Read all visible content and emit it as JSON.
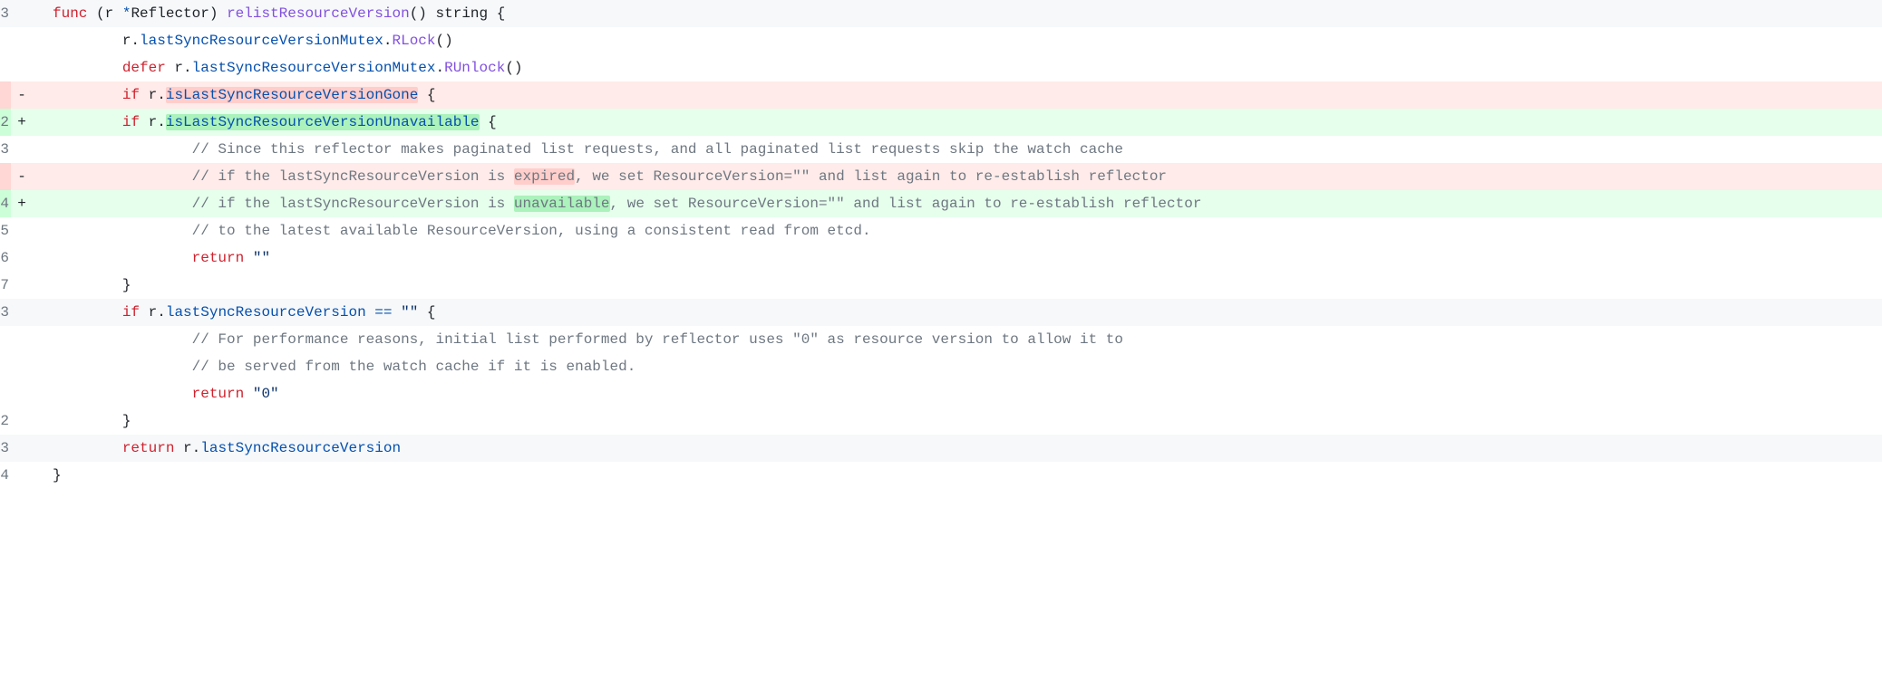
{
  "lines": [
    {
      "num": "3",
      "marker": "",
      "type": "hunk-header",
      "tokens": [
        {
          "t": "func ",
          "c": "tok-keyword"
        },
        {
          "t": "(",
          "c": "tok-paren"
        },
        {
          "t": "r ",
          "c": ""
        },
        {
          "t": "*",
          "c": "tok-op"
        },
        {
          "t": "Reflector",
          "c": "tok-type"
        },
        {
          "t": ") ",
          "c": "tok-paren"
        },
        {
          "t": "relistResourceVersion",
          "c": "tok-func"
        },
        {
          "t": "() ",
          "c": "tok-paren"
        },
        {
          "t": "string",
          "c": "tok-type"
        },
        {
          "t": " {",
          "c": ""
        }
      ]
    },
    {
      "num": "",
      "marker": "",
      "type": "context",
      "tokens": [
        {
          "t": "\t",
          "c": ""
        },
        {
          "t": "r",
          "c": ""
        },
        {
          "t": ".",
          "c": "tok-dot"
        },
        {
          "t": "lastSyncResourceVersionMutex",
          "c": "tok-ident"
        },
        {
          "t": ".",
          "c": "tok-dot"
        },
        {
          "t": "RLock",
          "c": "tok-func"
        },
        {
          "t": "()",
          "c": "tok-paren"
        }
      ]
    },
    {
      "num": "",
      "marker": "",
      "type": "context",
      "tokens": [
        {
          "t": "\t",
          "c": ""
        },
        {
          "t": "defer ",
          "c": "tok-keyword"
        },
        {
          "t": "r",
          "c": ""
        },
        {
          "t": ".",
          "c": "tok-dot"
        },
        {
          "t": "lastSyncResourceVersionMutex",
          "c": "tok-ident"
        },
        {
          "t": ".",
          "c": "tok-dot"
        },
        {
          "t": "RUnlock",
          "c": "tok-func"
        },
        {
          "t": "()",
          "c": "tok-paren"
        }
      ]
    },
    {
      "num": "",
      "marker": "",
      "type": "context",
      "tokens": []
    },
    {
      "num": "",
      "marker": "-",
      "type": "deletion",
      "tokens": [
        {
          "t": "\t",
          "c": ""
        },
        {
          "t": "if ",
          "c": "tok-keyword"
        },
        {
          "t": "r",
          "c": ""
        },
        {
          "t": ".",
          "c": "tok-dot"
        },
        {
          "t": "isLastSyncResourceVersionGone",
          "c": "tok-ident word-del"
        },
        {
          "t": " {",
          "c": ""
        }
      ]
    },
    {
      "num": "2",
      "marker": "+",
      "type": "addition",
      "tokens": [
        {
          "t": "\t",
          "c": ""
        },
        {
          "t": "if ",
          "c": "tok-keyword"
        },
        {
          "t": "r",
          "c": ""
        },
        {
          "t": ".",
          "c": "tok-dot"
        },
        {
          "t": "isLastSyncResourceVersionUnavailable",
          "c": "tok-ident word-add"
        },
        {
          "t": " {",
          "c": ""
        }
      ]
    },
    {
      "num": "3",
      "marker": "",
      "type": "context",
      "tokens": [
        {
          "t": "\t\t",
          "c": ""
        },
        {
          "t": "// Since this reflector makes paginated list requests, and all paginated list requests skip the watch cache",
          "c": "tok-comment"
        }
      ]
    },
    {
      "num": "",
      "marker": "-",
      "type": "deletion",
      "tokens": [
        {
          "t": "\t\t",
          "c": ""
        },
        {
          "t": "// if the lastSyncResourceVersion is ",
          "c": "tok-comment"
        },
        {
          "t": "expired",
          "c": "tok-comment word-del"
        },
        {
          "t": ", we set ResourceVersion=\"\" and list again to re-establish reflector",
          "c": "tok-comment"
        }
      ]
    },
    {
      "num": "4",
      "marker": "+",
      "type": "addition",
      "tokens": [
        {
          "t": "\t\t",
          "c": ""
        },
        {
          "t": "// if the lastSyncResourceVersion is ",
          "c": "tok-comment"
        },
        {
          "t": "unavailable",
          "c": "tok-comment word-add"
        },
        {
          "t": ", we set ResourceVersion=\"\" and list again to re-establish reflector",
          "c": "tok-comment"
        }
      ]
    },
    {
      "num": "5",
      "marker": "",
      "type": "context",
      "tokens": [
        {
          "t": "\t\t",
          "c": ""
        },
        {
          "t": "// to the latest available ResourceVersion, using a consistent read from etcd.",
          "c": "tok-comment"
        }
      ]
    },
    {
      "num": "6",
      "marker": "",
      "type": "context",
      "tokens": [
        {
          "t": "\t\t",
          "c": ""
        },
        {
          "t": "return ",
          "c": "tok-keyword"
        },
        {
          "t": "\"\"",
          "c": "tok-string"
        }
      ]
    },
    {
      "num": "7",
      "marker": "",
      "type": "context",
      "tokens": [
        {
          "t": "\t}",
          "c": ""
        }
      ]
    },
    {
      "num": "3",
      "marker": "",
      "type": "hunk-header",
      "tokens": [
        {
          "t": "\t",
          "c": ""
        },
        {
          "t": "if ",
          "c": "tok-keyword"
        },
        {
          "t": "r",
          "c": ""
        },
        {
          "t": ".",
          "c": "tok-dot"
        },
        {
          "t": "lastSyncResourceVersion",
          "c": "tok-ident"
        },
        {
          "t": " == ",
          "c": "tok-op"
        },
        {
          "t": "\"\"",
          "c": "tok-string"
        },
        {
          "t": " {",
          "c": ""
        }
      ]
    },
    {
      "num": "",
      "marker": "",
      "type": "context",
      "tokens": [
        {
          "t": "\t\t",
          "c": ""
        },
        {
          "t": "// For performance reasons, initial list performed by reflector uses \"0\" as resource version to allow it to",
          "c": "tok-comment"
        }
      ]
    },
    {
      "num": "",
      "marker": "",
      "type": "context",
      "tokens": [
        {
          "t": "\t\t",
          "c": ""
        },
        {
          "t": "// be served from the watch cache if it is enabled.",
          "c": "tok-comment"
        }
      ]
    },
    {
      "num": "",
      "marker": "",
      "type": "context",
      "tokens": [
        {
          "t": "\t\t",
          "c": ""
        },
        {
          "t": "return ",
          "c": "tok-keyword"
        },
        {
          "t": "\"0\"",
          "c": "tok-string"
        }
      ]
    },
    {
      "num": "2",
      "marker": "",
      "type": "context",
      "tokens": [
        {
          "t": "\t}",
          "c": ""
        }
      ]
    },
    {
      "num": "3",
      "marker": "",
      "type": "hunk-header",
      "tokens": [
        {
          "t": "\t",
          "c": ""
        },
        {
          "t": "return ",
          "c": "tok-keyword"
        },
        {
          "t": "r",
          "c": ""
        },
        {
          "t": ".",
          "c": "tok-dot"
        },
        {
          "t": "lastSyncResourceVersion",
          "c": "tok-ident"
        }
      ]
    },
    {
      "num": "4",
      "marker": "",
      "type": "context",
      "tokens": [
        {
          "t": "}",
          "c": ""
        }
      ]
    }
  ]
}
